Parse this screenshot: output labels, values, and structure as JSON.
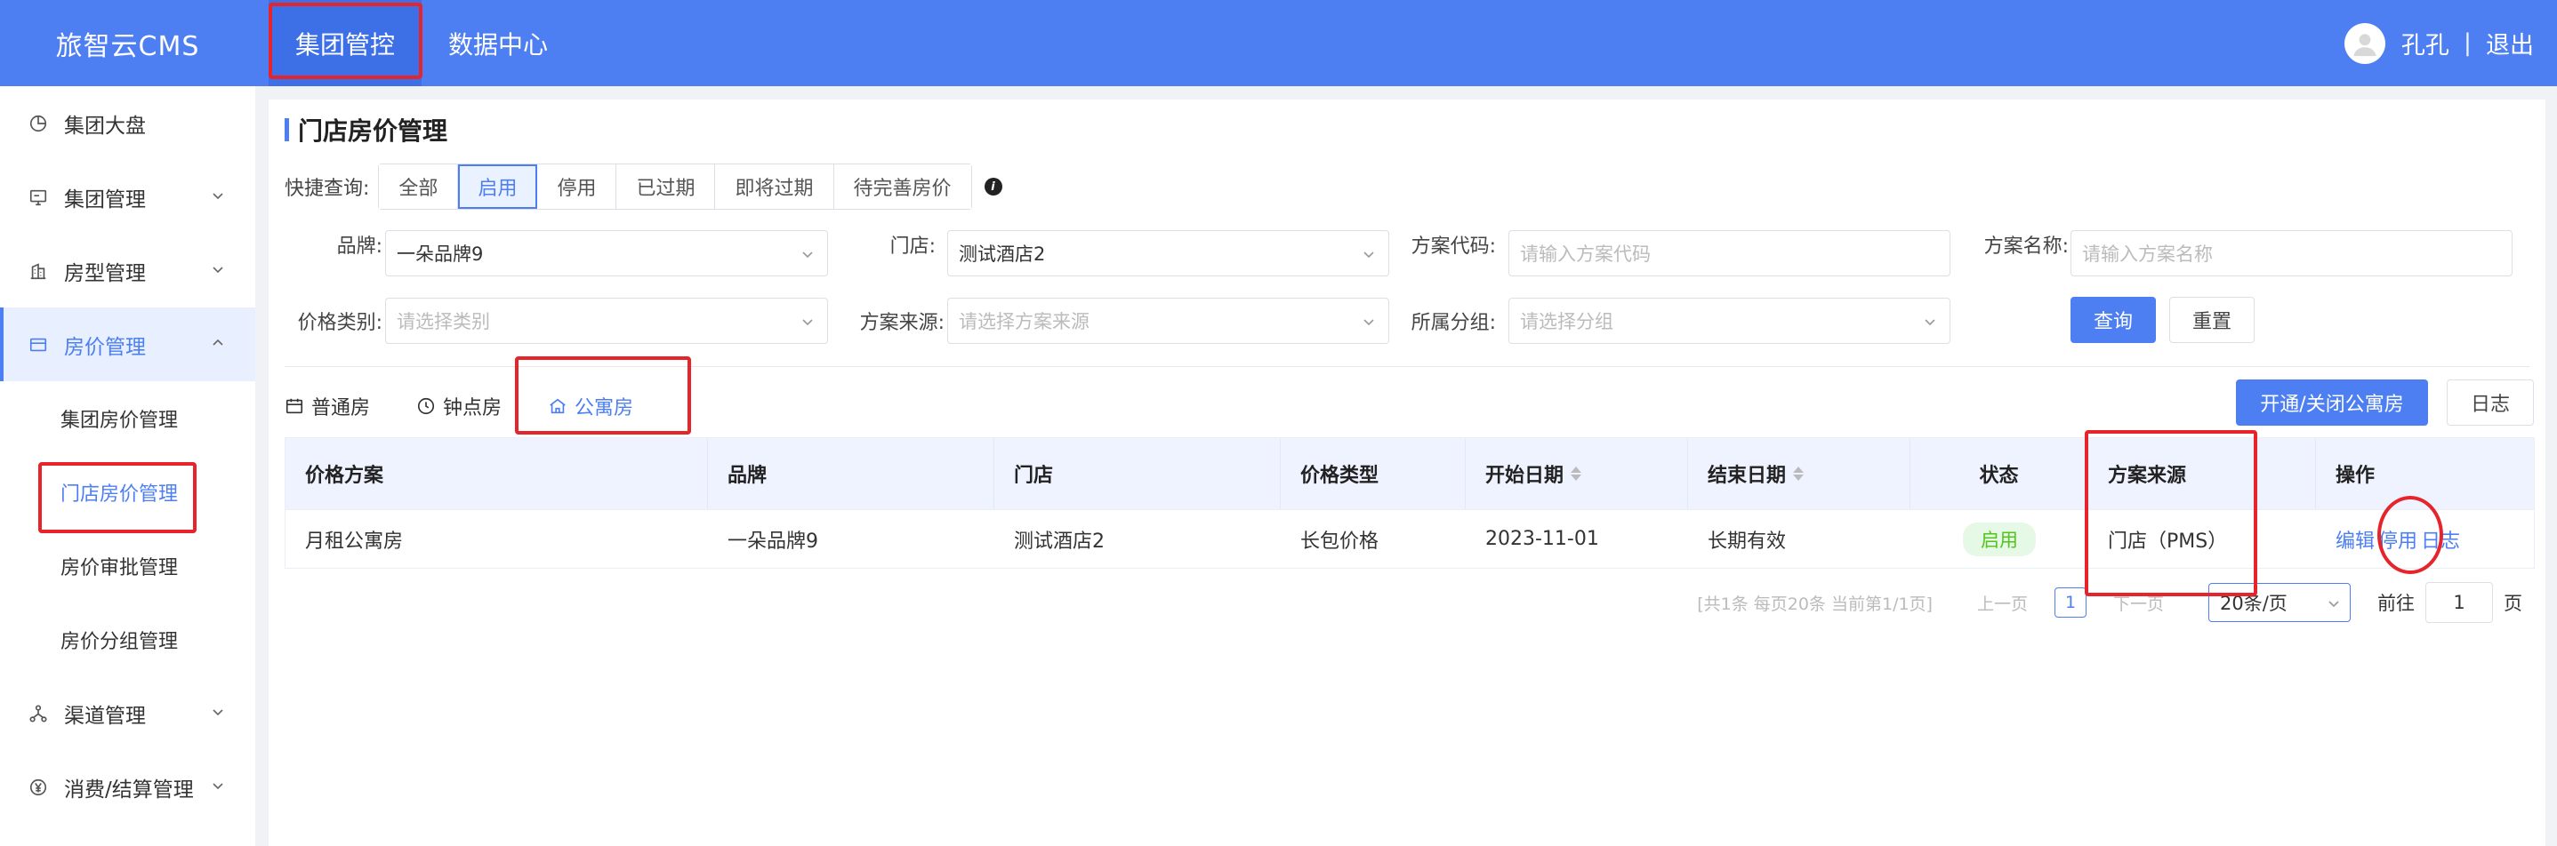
{
  "app": {
    "title": "旅智云CMS"
  },
  "topnav": [
    {
      "label": "集团管控",
      "active": true
    },
    {
      "label": "数据中心",
      "active": false
    }
  ],
  "user": {
    "name": "孔孔",
    "separator": "|",
    "logout": "退出"
  },
  "sidebar": {
    "items": [
      {
        "label": "集团大盘",
        "icon": "pie-chart-icon"
      },
      {
        "label": "集团管理",
        "icon": "monitor-icon"
      },
      {
        "label": "房型管理",
        "icon": "building-icon"
      },
      {
        "label": "房价管理",
        "icon": "card-icon"
      },
      {
        "label": "渠道管理",
        "icon": "network-icon"
      },
      {
        "label": "消费/结算管理",
        "icon": "yen-icon"
      }
    ],
    "subitems": [
      "集团房价管理",
      "门店房价管理",
      "房价审批管理",
      "房价分组管理"
    ]
  },
  "page": {
    "title": "门店房价管理"
  },
  "quick": {
    "label": "快捷查询:",
    "options": [
      "全部",
      "启用",
      "停用",
      "已过期",
      "即将过期",
      "待完善房价"
    ],
    "selected": "启用"
  },
  "filters": {
    "brand": {
      "label": "品牌:",
      "value": "一朵品牌9"
    },
    "store": {
      "label": "门店:",
      "value": "测试酒店2"
    },
    "plan_code": {
      "label": "方案代码:",
      "placeholder": "请输入方案代码"
    },
    "plan_name": {
      "label": "方案名称:",
      "placeholder": "请输入方案名称"
    },
    "price_type": {
      "label": "价格类别:",
      "placeholder": "请选择类别"
    },
    "plan_source": {
      "label": "方案来源:",
      "placeholder": "请选择方案来源"
    },
    "group": {
      "label": "所属分组:",
      "placeholder": "请选择分组"
    },
    "search_btn": "查询",
    "reset_btn": "重置"
  },
  "tabs": [
    {
      "label": "普通房",
      "icon": "calendar-icon"
    },
    {
      "label": "钟点房",
      "icon": "clock-icon"
    },
    {
      "label": "公寓房",
      "icon": "home-icon",
      "active": true
    }
  ],
  "actions": {
    "toggle_apartment": "开通/关闭公寓房",
    "log": "日志"
  },
  "table": {
    "headers": [
      "价格方案",
      "品牌",
      "门店",
      "价格类型",
      "开始日期",
      "结束日期",
      "状态",
      "方案来源",
      "操作"
    ],
    "rows": [
      {
        "plan": "月租公寓房",
        "brand": "一朵品牌9",
        "store": "测试酒店2",
        "price_type": "长包价格",
        "start": "2023-11-01",
        "end": "长期有效",
        "status": "启用",
        "source": "门店（PMS）",
        "ops": [
          "编辑",
          "停用",
          "日志"
        ]
      }
    ]
  },
  "pagination": {
    "summary": "[共1条 每页20条 当前第1/1页]",
    "prev": "上一页",
    "page": "1",
    "next": "下一页",
    "size": "20条/页",
    "goto_prefix": "前往",
    "goto_value": "1",
    "goto_suffix": "页"
  },
  "colors": {
    "primary": "#4d7ff2",
    "highlight": "#e5242b",
    "success": "#52c41a"
  }
}
